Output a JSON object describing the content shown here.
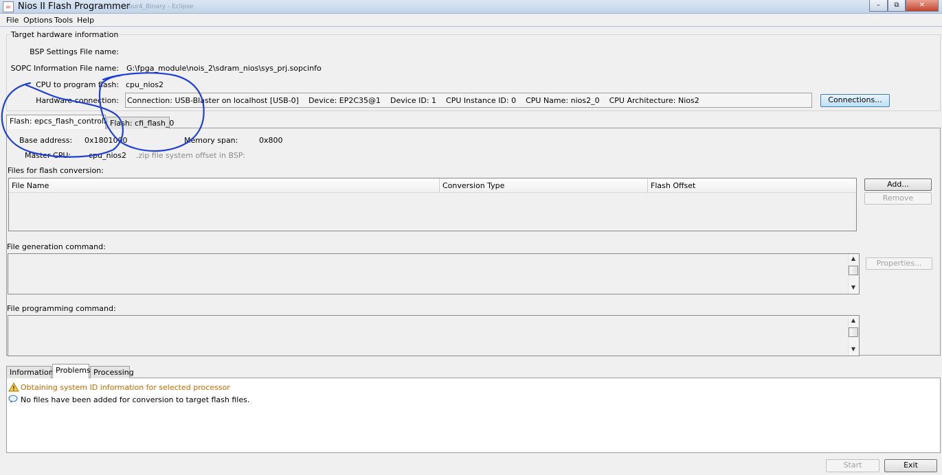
{
  "window": {
    "title": "Nios II Flash Programmer",
    "blurred_suffix": "cour4_Binary - Eclipse",
    "app_icon": "java-cup-icon",
    "minimize_glyph": "–",
    "restore_glyph": "⧉",
    "close_glyph": "✕"
  },
  "menu": [
    "File",
    "Options",
    "Tools",
    "Help"
  ],
  "target": {
    "group_title": "Target hardware information",
    "bsp_label": "BSP Settings File name:",
    "sopc_label": "SOPC Information File name:",
    "sopc_value": "G:\\fpga_module\\nois_2\\sdram_nios\\sys_prj.sopcinfo",
    "cpu_label": "CPU to program flash:",
    "cpu_value": "cpu_nios2",
    "hw_label": "Hardware connection:",
    "hw_value": "Connection: USB-Blaster on localhost [USB-0]    Device: EP2C35@1    Device ID: 1    CPU Instance ID: 0    CPU Name: nios2_0    CPU Architecture: Nios2",
    "connections_button": "Connections..."
  },
  "flash_tabs": [
    "Flash: epcs_flash_controller",
    "Flash: cfi_flash_0"
  ],
  "flash": {
    "base_address_label": "Base address:",
    "base_address_value": "0x1801000",
    "memory_span_label": "Memory span:",
    "memory_span_value": "0x800",
    "master_cpu_label": "Master CPU:",
    "master_cpu_value": "cpu_nios2",
    "zip_hint": ".zip file system offset in BSP:"
  },
  "files": {
    "section_label": "Files for flash conversion:",
    "columns": [
      "File Name",
      "Conversion Type",
      "Flash Offset"
    ],
    "add_button": "Add...",
    "remove_button": "Remove"
  },
  "generation": {
    "label": "File generation command:",
    "properties_button": "Properties..."
  },
  "programming": {
    "label": "File programming command:"
  },
  "bottom_tabs": [
    "Information",
    "Problems",
    "Processing"
  ],
  "messages": [
    {
      "icon": "warning-icon",
      "text": "Obtaining system ID information for selected processor"
    },
    {
      "icon": "info-speech-icon",
      "text": "No files have been added for conversion to target flash files."
    }
  ],
  "footer": {
    "start_button": "Start",
    "exit_button": "Exit"
  },
  "colors": {
    "ink": "#1f3fd0",
    "warning": "#c46a00"
  }
}
